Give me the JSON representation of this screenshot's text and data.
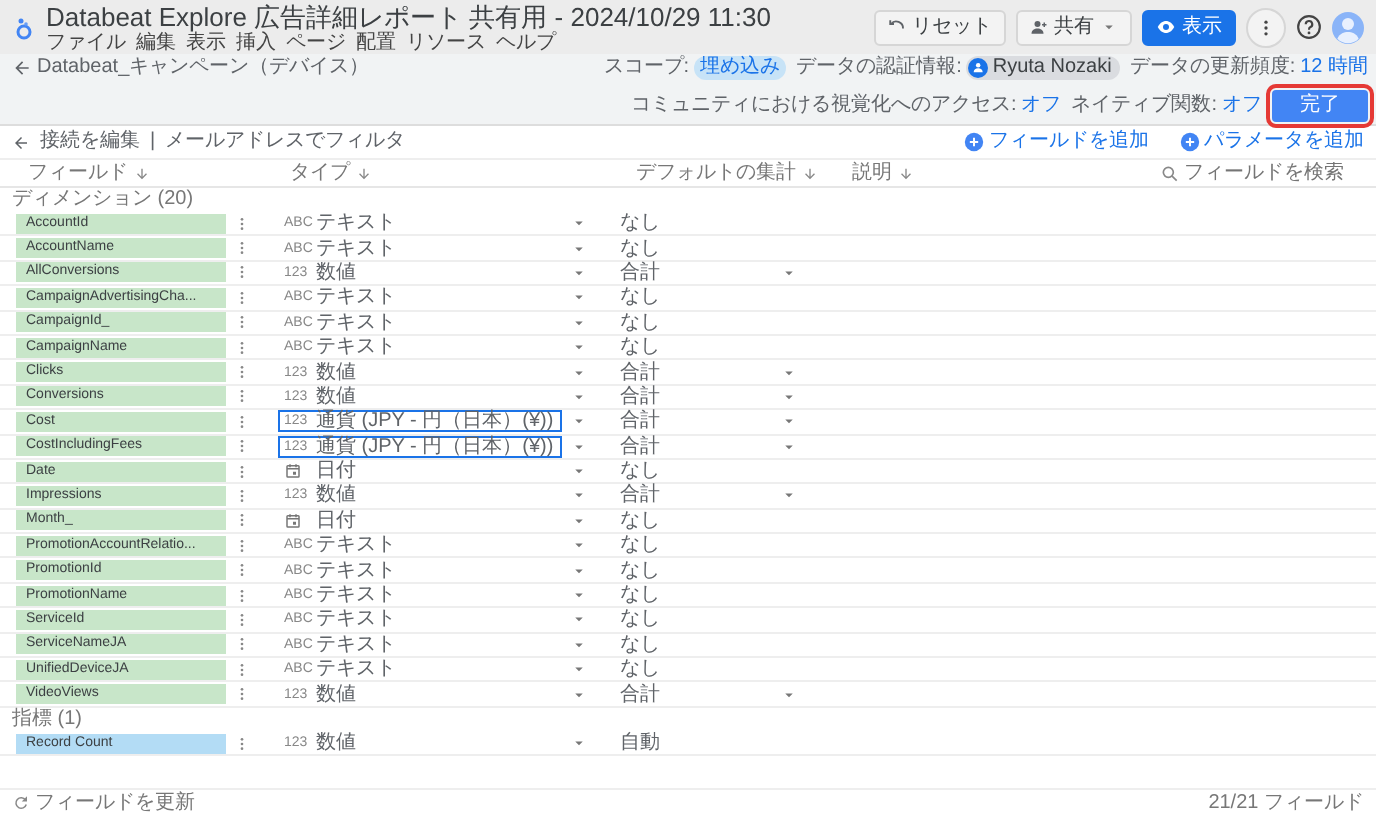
{
  "app": {
    "title": "Databeat Explore 広告詳細レポート 共有用 - 2024/10/29 11:30",
    "menu": [
      "ファイル",
      "編集",
      "表示",
      "挿入",
      "ページ",
      "配置",
      "リソース",
      "ヘルプ"
    ],
    "reset": "リセット",
    "share": "共有",
    "view": "表示"
  },
  "editor": {
    "data_source": "Databeat_キャンペーン（デバイス）",
    "scope_label": "スコープ:",
    "scope_value": "埋め込み",
    "credentials_label": "データの認証情報:",
    "credentials_user": "Ryuta Nozaki",
    "freshness_label": "データの更新頻度:",
    "freshness_value": "12 時間",
    "community_label": "コミュニティにおける視覚化へのアクセス:",
    "community_value": "オフ",
    "native_label": "ネイティブ関数:",
    "native_value": "オフ",
    "done": "完了",
    "done_highlighted": true
  },
  "actions": {
    "edit_connection": "接続を編集",
    "separator": "|",
    "filter": "メールアドレスでフィルタ",
    "add_field": "フィールドを追加",
    "add_parameter": "パラメータを追加"
  },
  "columns": [
    "フィールド",
    "タイプ",
    "デフォルトの集計",
    "説明"
  ],
  "search": {
    "placeholder": "フィールドを検索"
  },
  "groups": [
    {
      "label": "ディメンション (20)",
      "kind": "dimension",
      "fields": [
        {
          "name": "AccountId",
          "kind": "text",
          "type_icon": "ABC",
          "type": "テキスト",
          "aggregation": "なし",
          "aggregation_menu": false,
          "highlighted": false
        },
        {
          "name": "AccountName",
          "kind": "text",
          "type_icon": "ABC",
          "type": "テキスト",
          "aggregation": "なし",
          "aggregation_menu": false,
          "highlighted": false
        },
        {
          "name": "AllConversions",
          "kind": "number",
          "type_icon": "123",
          "type": "数値",
          "aggregation": "合計",
          "aggregation_menu": true,
          "highlighted": false
        },
        {
          "name": "CampaignAdvertisingCha...",
          "kind": "text",
          "type_icon": "ABC",
          "type": "テキスト",
          "aggregation": "なし",
          "aggregation_menu": false,
          "highlighted": false
        },
        {
          "name": "CampaignId_",
          "kind": "text",
          "type_icon": "ABC",
          "type": "テキスト",
          "aggregation": "なし",
          "aggregation_menu": false,
          "highlighted": false
        },
        {
          "name": "CampaignName",
          "kind": "text",
          "type_icon": "ABC",
          "type": "テキスト",
          "aggregation": "なし",
          "aggregation_menu": false,
          "highlighted": false
        },
        {
          "name": "Clicks",
          "kind": "number",
          "type_icon": "123",
          "type": "数値",
          "aggregation": "合計",
          "aggregation_menu": true,
          "highlighted": false
        },
        {
          "name": "Conversions",
          "kind": "number",
          "type_icon": "123",
          "type": "数値",
          "aggregation": "合計",
          "aggregation_menu": true,
          "highlighted": false
        },
        {
          "name": "Cost",
          "kind": "number",
          "type_icon": "123",
          "type": "通貨 (JPY - 円（日本）(¥))",
          "aggregation": "合計",
          "aggregation_menu": true,
          "highlighted": true
        },
        {
          "name": "CostIncludingFees",
          "kind": "number",
          "type_icon": "123",
          "type": "通貨 (JPY - 円（日本）(¥))",
          "aggregation": "合計",
          "aggregation_menu": true,
          "highlighted": true
        },
        {
          "name": "Date",
          "kind": "date",
          "type": "日付",
          "aggregation": "なし",
          "aggregation_menu": false,
          "highlighted": false
        },
        {
          "name": "Impressions",
          "kind": "number",
          "type_icon": "123",
          "type": "数値",
          "aggregation": "合計",
          "aggregation_menu": true,
          "highlighted": false
        },
        {
          "name": "Month_",
          "kind": "date",
          "type": "日付",
          "aggregation": "なし",
          "aggregation_menu": false,
          "highlighted": false
        },
        {
          "name": "PromotionAccountRelatio...",
          "kind": "text",
          "type_icon": "ABC",
          "type": "テキスト",
          "aggregation": "なし",
          "aggregation_menu": false,
          "highlighted": false
        },
        {
          "name": "PromotionId",
          "kind": "text",
          "type_icon": "ABC",
          "type": "テキスト",
          "aggregation": "なし",
          "aggregation_menu": false,
          "highlighted": false
        },
        {
          "name": "PromotionName",
          "kind": "text",
          "type_icon": "ABC",
          "type": "テキスト",
          "aggregation": "なし",
          "aggregation_menu": false,
          "highlighted": false
        },
        {
          "name": "ServiceId",
          "kind": "text",
          "type_icon": "ABC",
          "type": "テキスト",
          "aggregation": "なし",
          "aggregation_menu": false,
          "highlighted": false
        },
        {
          "name": "ServiceNameJA",
          "kind": "text",
          "type_icon": "ABC",
          "type": "テキスト",
          "aggregation": "なし",
          "aggregation_menu": false,
          "highlighted": false
        },
        {
          "name": "UnifiedDeviceJA",
          "kind": "text",
          "type_icon": "ABC",
          "type": "テキスト",
          "aggregation": "なし",
          "aggregation_menu": false,
          "highlighted": false
        },
        {
          "name": "VideoViews",
          "kind": "number",
          "type_icon": "123",
          "type": "数値",
          "aggregation": "合計",
          "aggregation_menu": true,
          "highlighted": false
        }
      ]
    },
    {
      "label": "指標 (1)",
      "kind": "metric",
      "fields": [
        {
          "name": "Record Count",
          "kind": "number",
          "type_icon": "123",
          "type": "数値",
          "aggregation": "自動",
          "aggregation_menu": false,
          "highlighted": false
        }
      ]
    }
  ],
  "footer": {
    "refresh": "フィールドを更新",
    "count": "21/21 フィールド"
  }
}
